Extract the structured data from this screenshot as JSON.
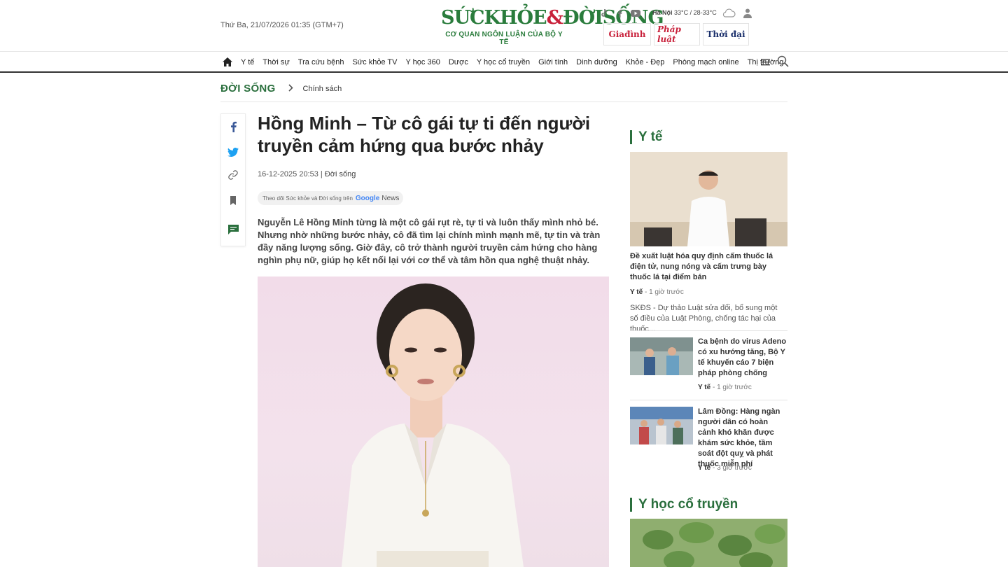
{
  "header": {
    "date": "Thứ Ba, 21/07/2026 01:35 (GTM+7)",
    "logo_main": "SỨCKHỎE",
    "logo_amp": "&",
    "logo_main2": "ĐỜISỐNG",
    "logo_sub": "CƠ QUAN NGÔN LUẬN CỦA BỘ Y TẾ",
    "weather_city": "Hà Nội",
    "weather_temp": "33°C / 28-33°C",
    "partners": [
      "Giađình",
      "Pháp luật",
      "Thời đại"
    ]
  },
  "nav": {
    "items": [
      "Y tế",
      "Thời sự",
      "Tra cứu bệnh",
      "Sức khỏe TV",
      "Y học 360",
      "Dược",
      "Y học cổ truyền",
      "Giới tính",
      "Dinh dưỡng",
      "Khỏe - Đẹp",
      "Phòng mạch online",
      "Thị trường"
    ]
  },
  "breadcrumb": {
    "section": "ĐỜI SỐNG",
    "subsection": "Chính sách"
  },
  "article": {
    "title": "Hồng Minh – Từ cô gái tự ti đến người truyền cảm hứng qua bước nhảy",
    "datetime": "16-12-2025 20:53",
    "separator": "|",
    "category": "Đời sống",
    "gnews_text": "Theo dõi Sức khỏe và Đời sống trên",
    "gnews_brand": "Google",
    "gnews_news": "News",
    "sapo": "Nguyễn Lê Hồng Minh từng là một cô gái rụt rè, tự ti và luôn thấy mình nhỏ bé. Nhưng nhờ những bước nhảy, cô đã tìm lại chính mình mạnh mẽ, tự tin và tràn đầy năng lượng sống. Giờ đây, cô trở thành người truyền cảm hứng cho hàng nghìn phụ nữ, giúp họ kết nối lại với cơ thể và tâm hồn qua nghệ thuật nhảy."
  },
  "sidebar": {
    "section1": "Y tế",
    "featured": {
      "title": "Đề xuất luật hóa quy định cấm thuốc lá điện tử, nung nóng và cấm trưng bày thuốc lá tại điểm bán",
      "category": "Y tế",
      "time": "1 giờ trước",
      "desc": "SKĐS - Dự thảo Luật sửa đổi, bổ sung một số điều của Luật Phòng, chống tác hại của thuốc..."
    },
    "items": [
      {
        "title": "Ca bệnh do virus Adeno có xu hướng tăng, Bộ Y tế khuyến cáo 7 biện pháp phòng chống",
        "category": "Y tế",
        "time": "1 giờ trước"
      },
      {
        "title": "Lâm Đồng: Hàng ngàn người dân có hoàn cảnh khó khăn được khám sức khỏe, tầm soát đột quỵ và phát thuốc miễn phí",
        "category": "Y tế",
        "time": "3 giờ trước"
      }
    ],
    "section2": "Y học cổ truyền"
  },
  "colors": {
    "brand_green": "#2a6f3d",
    "logo_red": "#c8203a"
  }
}
